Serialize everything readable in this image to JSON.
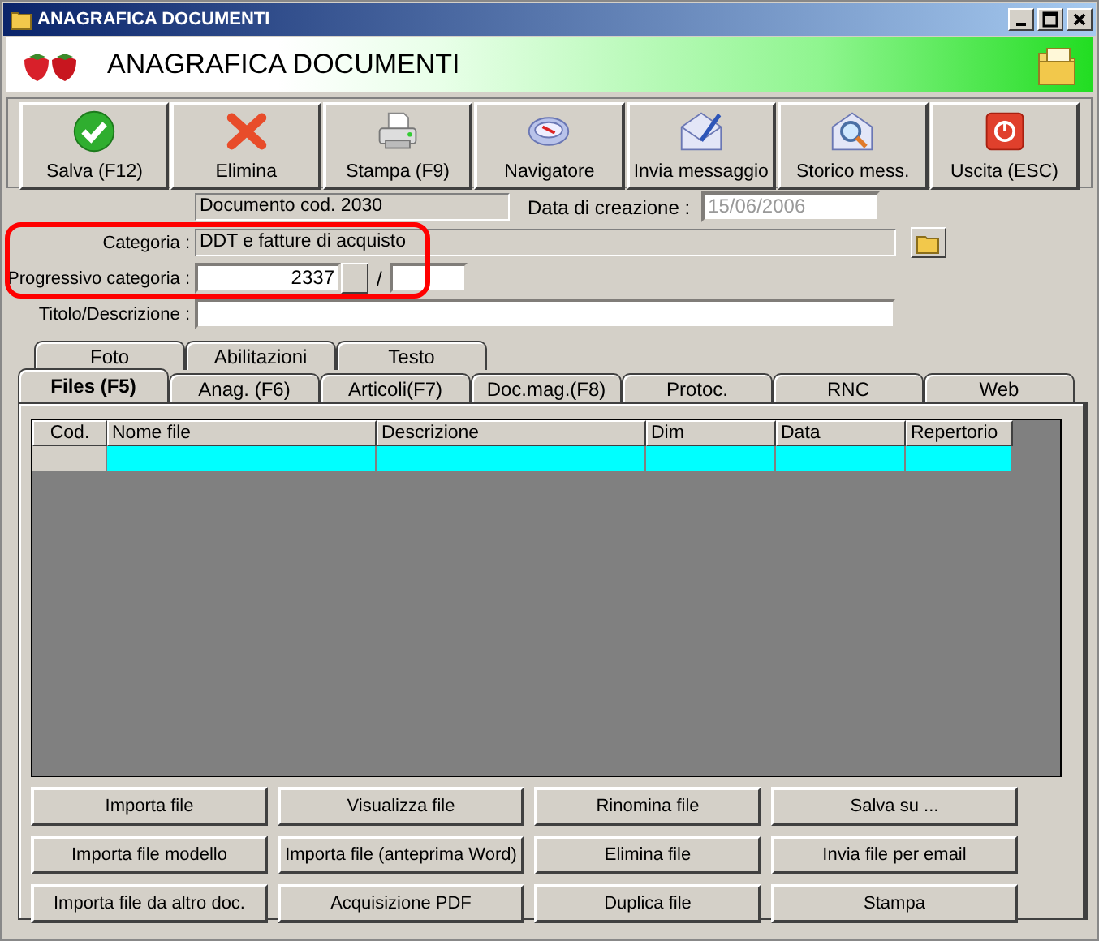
{
  "window": {
    "title": "ANAGRAFICA DOCUMENTI"
  },
  "banner": {
    "title": "ANAGRAFICA DOCUMENTI"
  },
  "toolbar": [
    {
      "kind": "save",
      "label": "Salva (F12)"
    },
    {
      "kind": "delete",
      "label": "Elimina"
    },
    {
      "kind": "print",
      "label": "Stampa (F9)"
    },
    {
      "kind": "compass",
      "label": "Navigatore"
    },
    {
      "kind": "mail",
      "label": "Invia messaggio"
    },
    {
      "kind": "history",
      "label": "Storico mess."
    },
    {
      "kind": "exit",
      "label": "Uscita (ESC)"
    }
  ],
  "form": {
    "document_code": "Documento cod. 2030",
    "creation_date_label": "Data di creazione :",
    "creation_date": "15/06/2006",
    "category_label": "Categoria :",
    "category": "DDT e fatture di acquisto",
    "progressive_label": "Progressivo categoria :",
    "progressive": "2337",
    "separator": "/",
    "title_label": "Titolo/Descrizione :"
  },
  "tabs_top": [
    {
      "label": "Foto",
      "selected": false
    },
    {
      "label": "Abilitazioni",
      "selected": false
    },
    {
      "label": "Testo",
      "selected": false
    }
  ],
  "tabs": [
    {
      "label": "Files (F5)",
      "selected": true
    },
    {
      "label": "Anag. (F6)",
      "selected": false
    },
    {
      "label": "Articoli(F7)",
      "selected": false
    },
    {
      "label": "Doc.mag.(F8)",
      "selected": false
    },
    {
      "label": "Protoc.",
      "selected": false
    },
    {
      "label": "RNC",
      "selected": false
    },
    {
      "label": "Web",
      "selected": false
    }
  ],
  "table": {
    "columns": [
      "Cod.",
      "Nome file",
      "Descrizione",
      "Dim",
      "Data",
      "Repertorio"
    ],
    "rows": [
      {
        "selected": true
      }
    ]
  },
  "buttons": [
    [
      "Importa file",
      "Visualizza file",
      "Rinomina file",
      "Salva su ..."
    ],
    [
      "Importa file modello",
      "Importa file (anteprima Word)",
      "Elimina file",
      "Invia file per email"
    ],
    [
      "Importa file da altro doc.",
      "Acquisizione PDF",
      "Duplica file",
      "Stampa"
    ]
  ],
  "annotation": {
    "kind": "highlight"
  }
}
